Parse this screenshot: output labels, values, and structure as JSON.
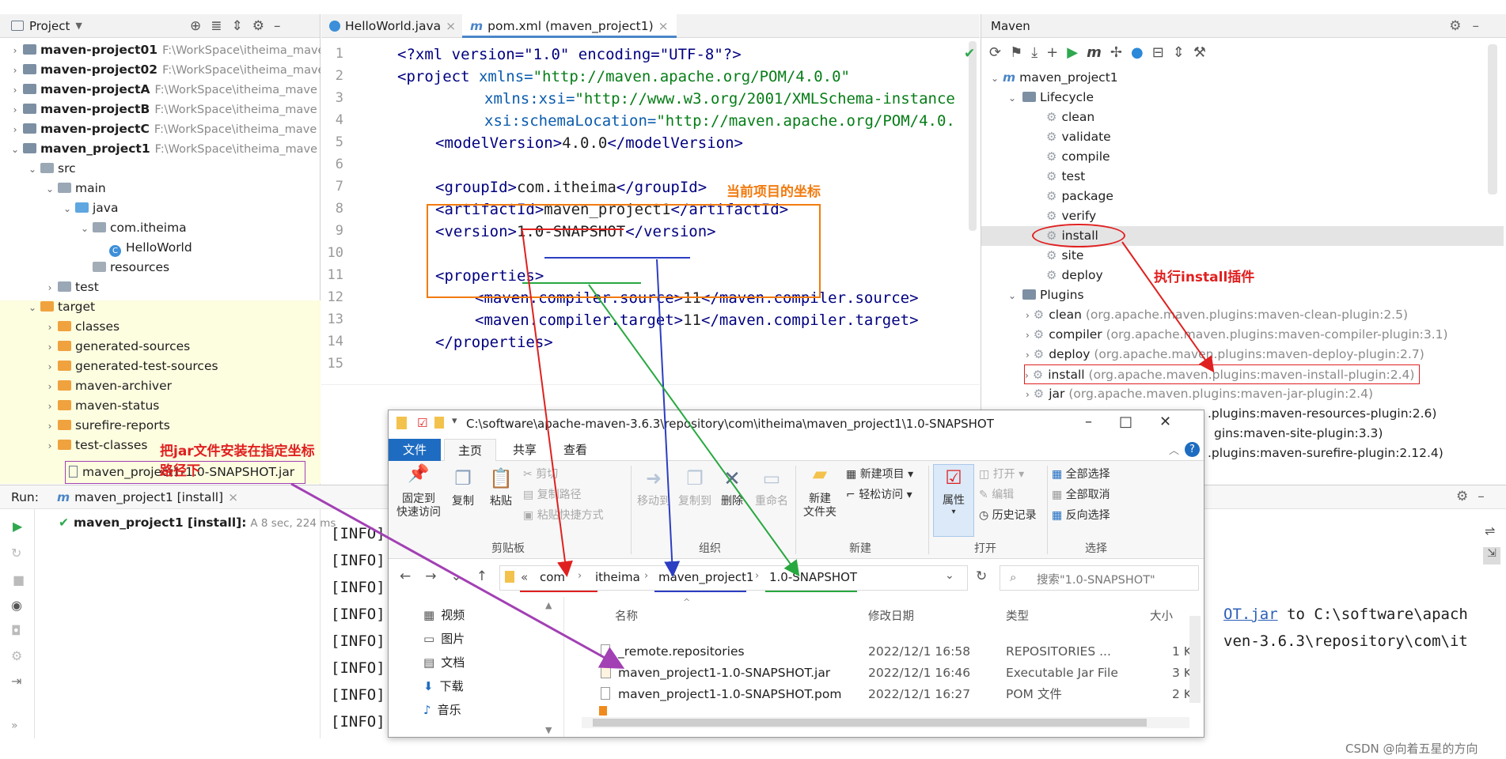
{
  "project_panel": {
    "title": "Project",
    "items": [
      {
        "name": "maven-project01",
        "path": "F:\\WorkSpace\\itheima_mave"
      },
      {
        "name": "maven-project02",
        "path": "F:\\WorkSpace\\itheima_mave"
      },
      {
        "name": "maven-projectA",
        "path": "F:\\WorkSpace\\itheima_mave"
      },
      {
        "name": "maven-projectB",
        "path": "F:\\WorkSpace\\itheima_mave"
      },
      {
        "name": "maven-projectC",
        "path": "F:\\WorkSpace\\itheima_mave"
      },
      {
        "name": "maven_project1",
        "path": "F:\\WorkSpace\\itheima_mave"
      }
    ],
    "tree": {
      "src": "src",
      "main": "main",
      "java": "java",
      "package": "com.itheima",
      "class": "HelloWorld",
      "resources": "resources",
      "test": "test",
      "target": "target",
      "target_children": [
        "classes",
        "generated-sources",
        "generated-test-sources",
        "maven-archiver",
        "maven-status",
        "surefire-reports",
        "test-classes"
      ],
      "jar": "maven_project1-1.0-SNAPSHOT.jar"
    }
  },
  "editor": {
    "tabs": [
      {
        "label": "HelloWorld.java"
      },
      {
        "label": "pom.xml (maven_project1)"
      }
    ],
    "line_numbers": [
      "1",
      "2",
      "3",
      "4",
      "5",
      "6",
      "7",
      "8",
      "9",
      "10",
      "11",
      "12",
      "13",
      "14",
      "15"
    ],
    "code": {
      "l1": "<?xml version=\"1.0\" encoding=\"UTF-8\"?>",
      "l2a": "<project",
      "l2b": " xmlns=",
      "l2c": "\"http://maven.apache.org/POM/4.0.0\"",
      "l3a": "xmlns:xsi=",
      "l3b": "\"http://www.w3.org/2001/XMLSchema-instance",
      "l4a": "xsi:schemaLocation=",
      "l4b": "\"http://maven.apache.org/POM/4.0.",
      "l5a": "<modelVersion>",
      "l5b": "4.0.0",
      "l5c": "</modelVersion>",
      "l7a": "<groupId>",
      "l7b": "com.itheima",
      "l7c": "</groupId>",
      "l8a": "<artifactId>",
      "l8b": "maven_project1",
      "l8c": "</artifactId>",
      "l9a": "<version>",
      "l9b": "1.0-SNAPSHOT",
      "l9c": "</version>",
      "l11": "<properties>",
      "l12a": "<maven.compiler.source>",
      "l12b": "11",
      "l12c": "</maven.compiler.source>",
      "l13a": "<maven.compiler.target>",
      "l13b": "11",
      "l13c": "</maven.compiler.target>",
      "l14": "</properties>"
    }
  },
  "maven_panel": {
    "title": "Maven",
    "project": "maven_project1",
    "lifecycle_label": "Lifecycle",
    "lifecycle": [
      "clean",
      "validate",
      "compile",
      "test",
      "package",
      "verify",
      "install",
      "site",
      "deploy"
    ],
    "plugins_label": "Plugins",
    "plugins": [
      {
        "name": "clean",
        "coord": "(org.apache.maven.plugins:maven-clean-plugin:2.5)"
      },
      {
        "name": "compiler",
        "coord": "(org.apache.maven.plugins:maven-compiler-plugin:3.1)"
      },
      {
        "name": "deploy",
        "coord": "(org.apache.maven.plugins:maven-deploy-plugin:2.7)"
      },
      {
        "name": "install",
        "coord": "(org.apache.maven.plugins:maven-install-plugin:2.4)"
      },
      {
        "name": "jar",
        "coord": "(org.apache.maven.plugins:maven-jar-plugin:2.4)"
      }
    ],
    "hidden_plugins": [
      ".plugins:maven-resources-plugin:2.6)",
      "gins:maven-site-plugin:3.3)",
      ".plugins:maven-surefire-plugin:2.12.4)"
    ]
  },
  "run_panel": {
    "label": "Run:",
    "tab": "maven_project1 [install]",
    "entry_name": "maven_project1 [install]:",
    "entry_time": "A 8 sec, 224 ms",
    "info_lines": [
      "[INFO]",
      "[INFO]",
      "[INFO]",
      "[INFO]",
      "[INFO]",
      "[INFO]",
      "[INFO]",
      "[INFO]"
    ],
    "right_line1a": "OT.jar",
    "right_line1b": " to C:\\software\\apach",
    "right_line2": "ven-3.6.3\\repository\\com\\it"
  },
  "explorer": {
    "title_path": "C:\\software\\apache-maven-3.6.3\\repository\\com\\itheima\\maven_project1\\1.0-SNAPSHOT",
    "ribbon_tabs": [
      "文件",
      "主页",
      "共享",
      "查看"
    ],
    "ribbon": {
      "pin": "固定到\n快速访问",
      "copy": "复制",
      "paste": "粘贴",
      "cut": "剪切",
      "copy_path": "复制路径",
      "paste_shortcut": "粘贴快捷方式",
      "move_to": "移动到",
      "copy_to": "复制到",
      "delete": "删除",
      "rename": "重命名",
      "new_folder": "新建\n文件夹",
      "new_item": "新建项目",
      "easy_access": "轻松访问",
      "properties": "属性",
      "open": "打开",
      "edit": "编辑",
      "history": "历史记录",
      "select_all": "全部选择",
      "select_none": "全部取消",
      "invert": "反向选择",
      "groups": [
        "剪贴板",
        "组织",
        "新建",
        "打开",
        "选择"
      ]
    },
    "breadcrumb": [
      "«",
      "com",
      "itheima",
      "maven_project1",
      "1.0-SNAPSHOT"
    ],
    "search_placeholder": "搜索\"1.0-SNAPSHOT\"",
    "sidebar": [
      "视频",
      "图片",
      "文档",
      "下载",
      "音乐"
    ],
    "columns": [
      "名称",
      "修改日期",
      "类型",
      "大小"
    ],
    "files": [
      {
        "name": "_remote.repositories",
        "date": "2022/12/1 16:58",
        "type": "REPOSITORIES ...",
        "size": "1 K"
      },
      {
        "name": "maven_project1-1.0-SNAPSHOT.jar",
        "date": "2022/12/1 16:46",
        "type": "Executable Jar File",
        "size": "3 K"
      },
      {
        "name": "maven_project1-1.0-SNAPSHOT.pom",
        "date": "2022/12/1 16:27",
        "type": "POM 文件",
        "size": "2 K"
      }
    ]
  },
  "annotations": {
    "coord_label": "当前项目的坐标",
    "install_label": "执行install插件",
    "jar_label": "把jar文件安装在指定坐标路径下"
  },
  "watermark": "CSDN @向着五星的方向",
  "colors": {
    "red": "#e02020",
    "blue": "#2c3ec2",
    "green": "#27a83f",
    "purple": "#a240b4",
    "orange": "#f27b0f"
  }
}
